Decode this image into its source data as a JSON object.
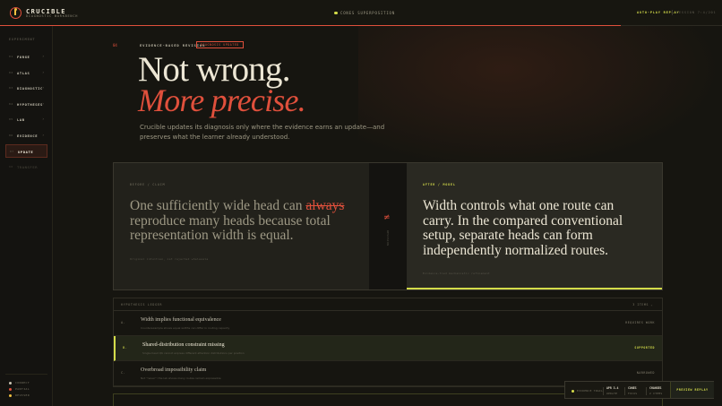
{
  "header": {
    "brand": "CRUCIBLE",
    "brand_sub": "DIAGNOSTIC WORKBENCH",
    "status": "CONES SUPERPOSITION",
    "replay": "AUTO-PLAY REPLAY",
    "session": "SESSION 7:4/201",
    "progress": 0.86
  },
  "sidebar": {
    "title": "EXPERIMENT",
    "items": [
      {
        "num": "01",
        "label": "FORGE",
        "chev": "›"
      },
      {
        "num": "02",
        "label": "ATLAS",
        "chev": "›"
      },
      {
        "num": "03",
        "label": "DIAGNOSTIC",
        "chev": "›"
      },
      {
        "num": "04",
        "label": "HYPOTHESES",
        "chev": "›"
      },
      {
        "num": "05",
        "label": "LAB",
        "chev": "›"
      },
      {
        "num": "06",
        "label": "EVIDENCE",
        "chev": "›"
      },
      {
        "num": "07",
        "label": "UPDATE",
        "chev": ""
      },
      {
        "num": "08",
        "label": "TRANSFER",
        "chev": ""
      }
    ],
    "legend": [
      "CORRECT",
      "PARTIAL",
      "REVISED"
    ]
  },
  "hero": {
    "step": "04",
    "eyebrow": "EVIDENCE-BASED REVISION",
    "badge": "DIAGNOSIS UPDATED",
    "line1": "Not wrong.",
    "line2": "More precise.",
    "description": "Crucible updates its diagnosis only where the evidence earns an update—and preserves what the learner already understood."
  },
  "compare": {
    "before_tag": "BEFORE / CLAIM",
    "before_text_pre": "One sufficiently wide head can ",
    "before_strike": "always",
    "before_text_post": " reproduce many heads because total representation width is equal.",
    "before_note": "Original intuition, not rejected wholesale",
    "divider_symbol": "≠",
    "divider_label": "REVISION",
    "after_tag": "AFTER / MODEL",
    "after_text": "Width controls what one route can carry. In the compared conventional setup, separate heads can form independently normalized routes.",
    "after_note": "Evidence-tied mechanistic refinement"
  },
  "list": {
    "title": "HYPOTHESIS LEDGER",
    "right": "3 ITEMS ⌄",
    "rows": [
      {
        "idx": "A.",
        "title": "Width implies functional equivalence",
        "sub": "Counterexample shows equal widths can differ in routing capacity",
        "status": "REQUIRES WORK"
      },
      {
        "idx": "B.",
        "title": "Shared-distribution constraint missing",
        "sub": "Single-head QK cannot express different attention distributions per position",
        "status": "SUPPORTED"
      },
      {
        "idx": "C.",
        "title": "Overbroad impossibility claim",
        "sub": "Not \"never\": the lab shows many routes remain expressible",
        "status": "NARROWED"
      }
    ]
  },
  "toolbar": {
    "label1": "EVIDENCE TRAIL",
    "v2": "APR 3.4",
    "l2": "UPDATE",
    "v3": "CONES",
    "l3": "FOCUS",
    "v4": "CHANGES",
    "l4": "2 ITEMS",
    "button": "PREVIEW REPLAY"
  },
  "colors": {
    "accent_red": "#e0503c",
    "accent_lime": "#d4dc4a",
    "background": "#161510"
  }
}
